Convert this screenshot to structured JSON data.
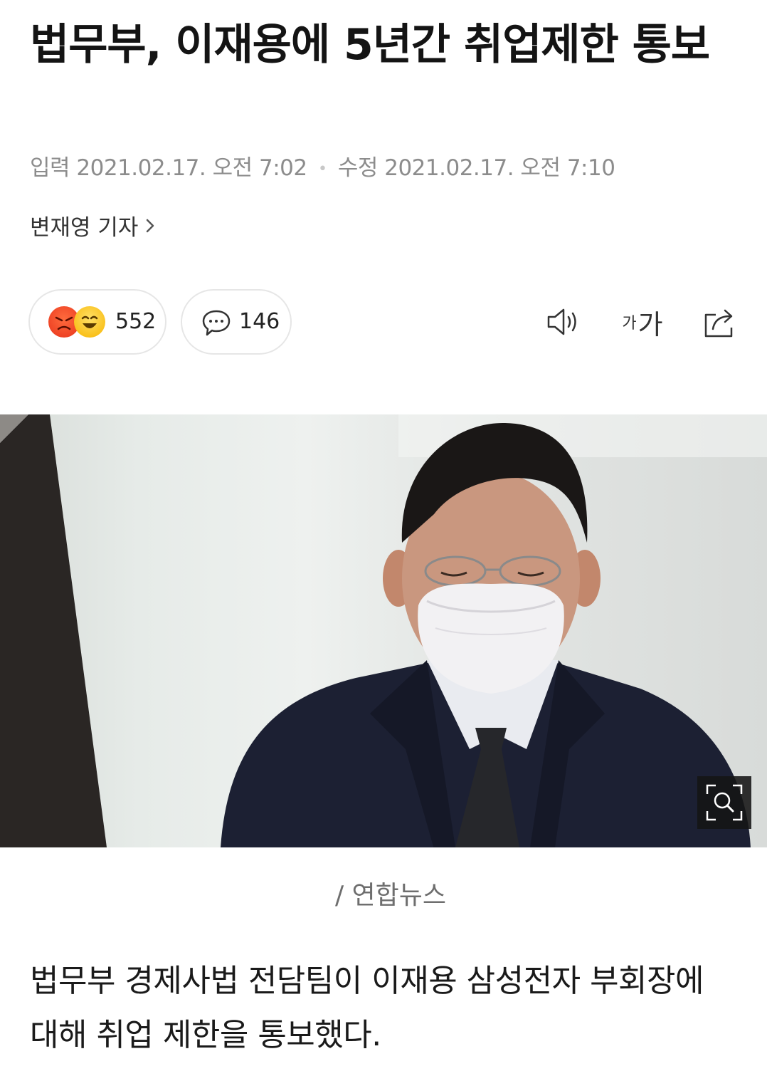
{
  "article": {
    "headline": "법무부, 이재용에 5년간 취업제한 통보",
    "published_label": "입력",
    "published_value": "2021.02.17. 오전 7:02",
    "modified_label": "수정",
    "modified_value": "2021.02.17. 오전 7:10",
    "reporter": "변재영 기자",
    "photo_caption": "/ 연합뉴스",
    "body": "법무부 경제사법 전담팀이 이재용 삼성전자 부회장에 대해 취업 제한을 통보했다."
  },
  "actions": {
    "reaction_count": "552",
    "comment_count": "146",
    "font_small_glyph": "가",
    "font_large_glyph": "가"
  },
  "icons": {
    "reaction_1": "angry-face-icon",
    "reaction_2": "laughing-face-icon",
    "comment": "speech-bubble-icon",
    "audio": "speaker-icon",
    "share": "share-icon",
    "zoom": "magnifier-icon",
    "reporter_link": "chevron-right-icon"
  },
  "colors": {
    "meta_text": "#8c8c8c",
    "angry": "#e8341c",
    "laugh": "#f7b500"
  }
}
